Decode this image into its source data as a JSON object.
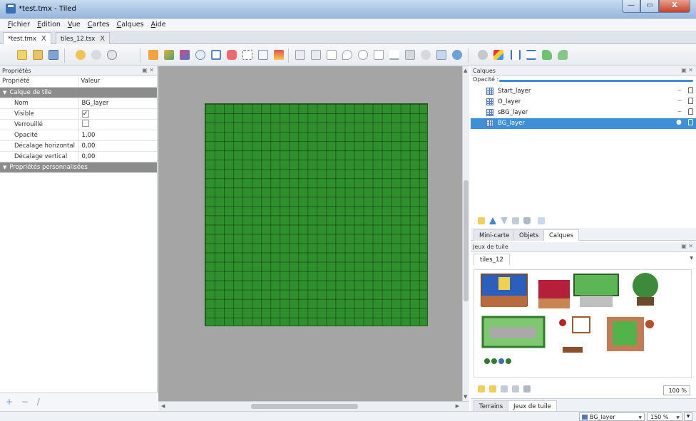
{
  "window": {
    "title": "*test.tmx - Tiled"
  },
  "window_controls": {
    "minimize": "—",
    "maximize": "▭",
    "close": "X"
  },
  "menubar": [
    {
      "label": "Fichier",
      "u": "F",
      "rest": "ichier"
    },
    {
      "label": "Edition",
      "u": "E",
      "rest": "dition"
    },
    {
      "label": "Vue",
      "u": "V",
      "rest": "ue"
    },
    {
      "label": "Cartes",
      "u": "C",
      "rest": "artes"
    },
    {
      "label": "Calques",
      "u": "C",
      "rest": "alques"
    },
    {
      "label": "Aide",
      "u": "A",
      "rest": "ide"
    }
  ],
  "doc_tabs": [
    {
      "label": "*test.tmx",
      "close": "X",
      "active": true
    },
    {
      "label": "tiles_12.tsx",
      "close": "X",
      "active": false
    }
  ],
  "properties": {
    "panel_title": "Propriétés",
    "col_property": "Propriété",
    "col_value": "Valeur",
    "group_tile_layer": "Calque de tile",
    "rows": [
      {
        "key": "Nom",
        "value": "BG_layer"
      },
      {
        "key": "Visible",
        "value": "✓"
      },
      {
        "key": "Verrouillé",
        "value": ""
      },
      {
        "key": "Opacité",
        "value": "1,00"
      },
      {
        "key": "Décalage horizontal",
        "value": "0,00"
      },
      {
        "key": "Décalage vertical",
        "value": "0,00"
      }
    ],
    "group_custom": "Propriétés personnalisées",
    "footer": {
      "add": "+",
      "remove": "−",
      "edit": "/"
    }
  },
  "layers_panel": {
    "title": "Calques",
    "opacity_label": "Opacité :",
    "layers": [
      {
        "name": "Start_layer",
        "eye": "⌣",
        "selected": false
      },
      {
        "name": "O_layer",
        "eye": "⌣",
        "selected": false
      },
      {
        "name": "sBG_layer",
        "eye": "⌣",
        "selected": false
      },
      {
        "name": "BG_layer",
        "eye": "●",
        "selected": true
      }
    ],
    "tabs": [
      "Mini-carte",
      "Objets",
      "Calques"
    ],
    "active_tab": "Calques"
  },
  "tilesets_panel": {
    "title": "Jeux de tuile",
    "tab": "tiles_12",
    "zoom": "100 %",
    "bottom_tabs": [
      "Terrains",
      "Jeux de tuile"
    ],
    "active_bottom_tab": "Jeux de tuile"
  },
  "statusbar": {
    "current_layer": "BG_layer",
    "zoom": "150 %"
  },
  "colors": {
    "map_green": "#2f8f2c",
    "selection_blue": "#3d8fd6",
    "canvas_gray": "#a5a5a5"
  }
}
